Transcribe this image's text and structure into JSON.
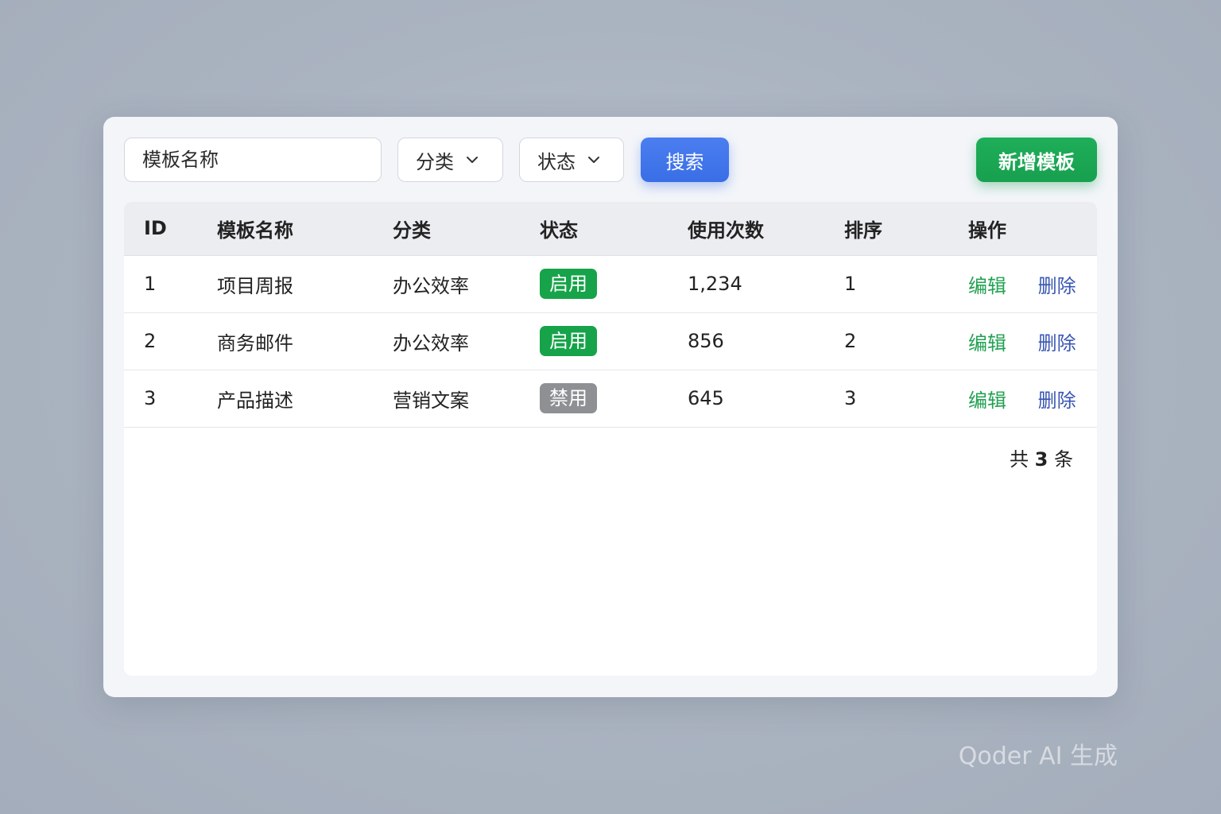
{
  "toolbar": {
    "name_input_placeholder": "模板名称",
    "category_select": "分类",
    "status_select": "状态",
    "search_button": "搜索",
    "add_button": "新增模板"
  },
  "table": {
    "headers": {
      "id": "ID",
      "name": "模板名称",
      "category": "分类",
      "status": "状态",
      "usage_count": "使用次数",
      "sort": "排序",
      "actions": "操作"
    },
    "rows": [
      {
        "id": "1",
        "name": "项目周报",
        "category": "办公效率",
        "status": "启用",
        "status_color": "#16a34a",
        "usage_count": "1,234",
        "sort": "1",
        "edit": "编辑",
        "delete": "删除"
      },
      {
        "id": "2",
        "name": "商务邮件",
        "category": "办公效率",
        "status": "启用",
        "status_color": "#16a34a",
        "usage_count": "856",
        "sort": "2",
        "edit": "编辑",
        "delete": "删除"
      },
      {
        "id": "3",
        "name": "产品描述",
        "category": "营销文案",
        "status": "禁用",
        "status_color": "#8e9094",
        "usage_count": "645",
        "sort": "3",
        "edit": "编辑",
        "delete": "删除"
      }
    ]
  },
  "footer": {
    "total_prefix": "共",
    "total_count": "3",
    "total_suffix": "条"
  },
  "watermark": "Qoder AI 生成",
  "colors": {
    "primary_blue": "#3a6ee6",
    "success_green": "#17a04f",
    "disabled_gray": "#8e9094",
    "delete_link": "#3856b3"
  }
}
